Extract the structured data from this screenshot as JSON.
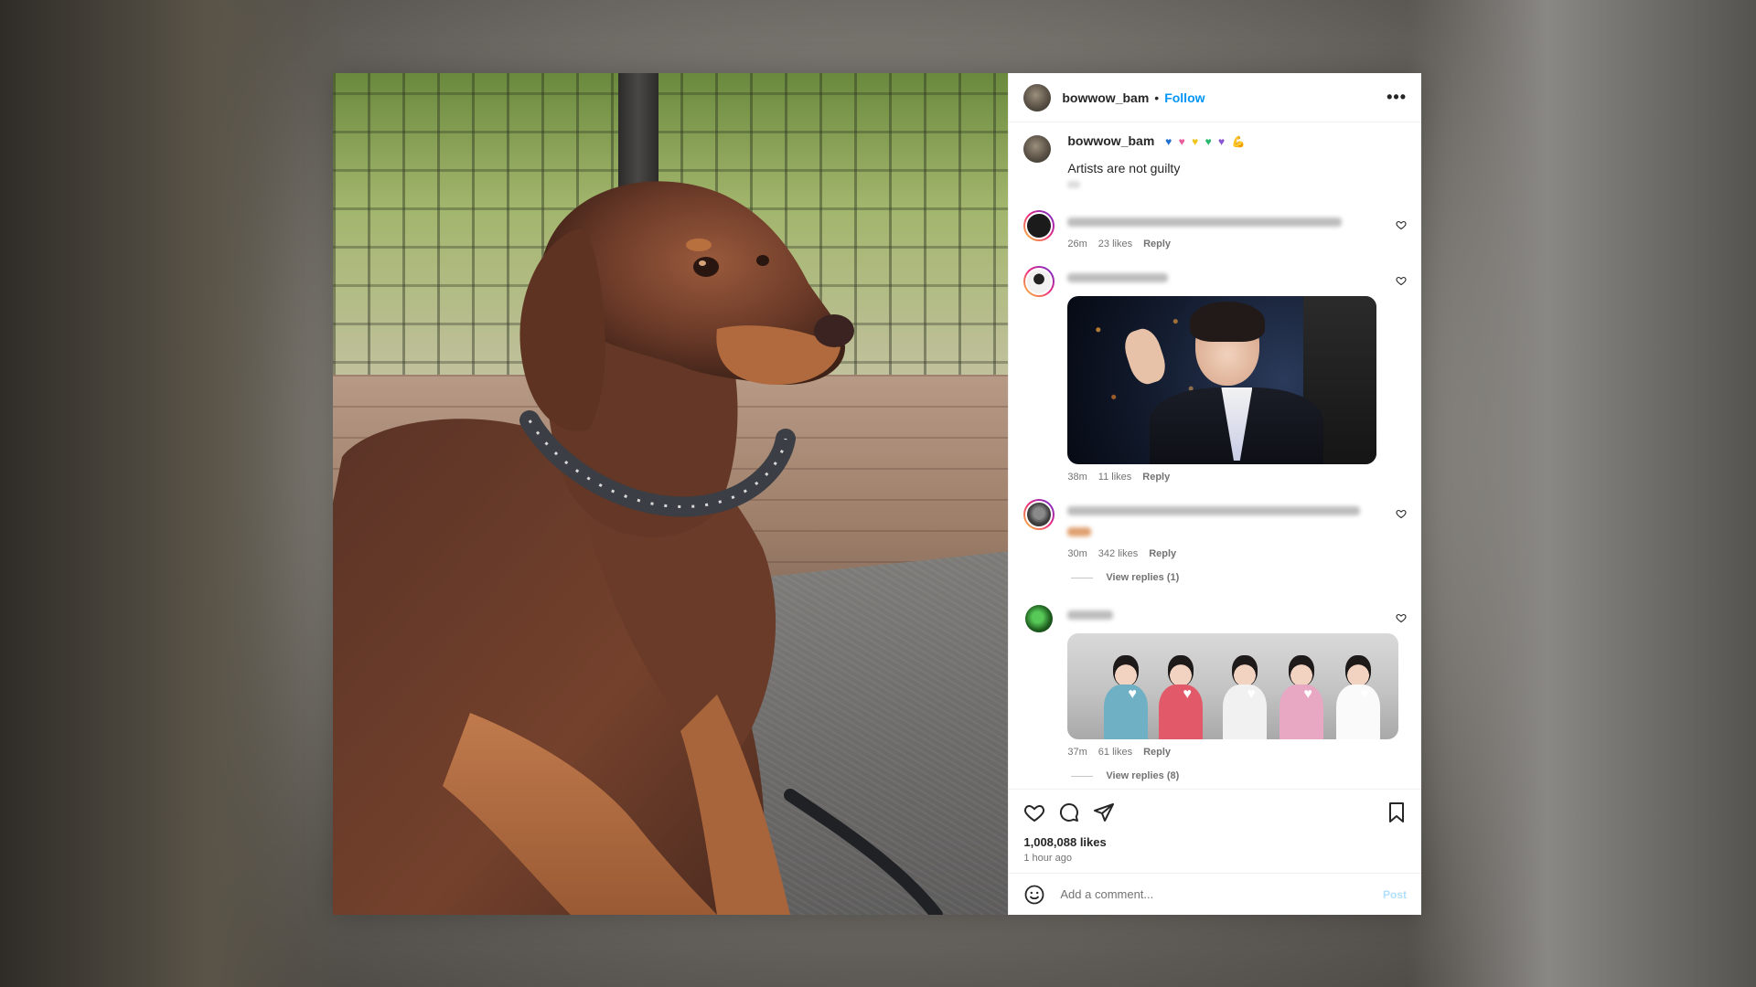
{
  "header": {
    "username": "bowwow_bam",
    "separator": "•",
    "follow_label": "Follow",
    "more_label": "•••"
  },
  "caption": {
    "username": "bowwow_bam",
    "emojis": [
      "♥",
      "♥",
      "♥",
      "♥",
      "♥",
      "💪"
    ],
    "emoji_colors": [
      "#1f6fd1",
      "#ea5d9d",
      "#f0c419",
      "#25b86d",
      "#8a55d3",
      "#f3c58d"
    ],
    "text": "Artists are not guilty"
  },
  "comments": [
    {
      "time": "26m",
      "likes": "23 likes",
      "reply_label": "Reply",
      "avatar_color": "#1b1b1b"
    },
    {
      "time": "38m",
      "likes": "11 likes",
      "reply_label": "Reply",
      "avatar_color": "#e6e6e6",
      "has_gif": "gif1"
    },
    {
      "time": "30m",
      "likes": "342 likes",
      "reply_label": "Reply",
      "avatar_color": "#5a5a5a",
      "view_replies": "View replies (1)"
    },
    {
      "time": "37m",
      "likes": "61 likes",
      "reply_label": "Reply",
      "avatar_color": "#2b8a2b",
      "has_gif": "gif2",
      "view_replies": "View replies (8)"
    }
  ],
  "actions": {
    "like_icon": "heart-icon",
    "comment_icon": "comment-icon",
    "share_icon": "send-icon",
    "save_icon": "bookmark-icon"
  },
  "likes_count": "1,008,088 likes",
  "posted_time": "1 hour ago",
  "add_comment": {
    "placeholder": "Add a comment...",
    "post_label": "Post"
  }
}
